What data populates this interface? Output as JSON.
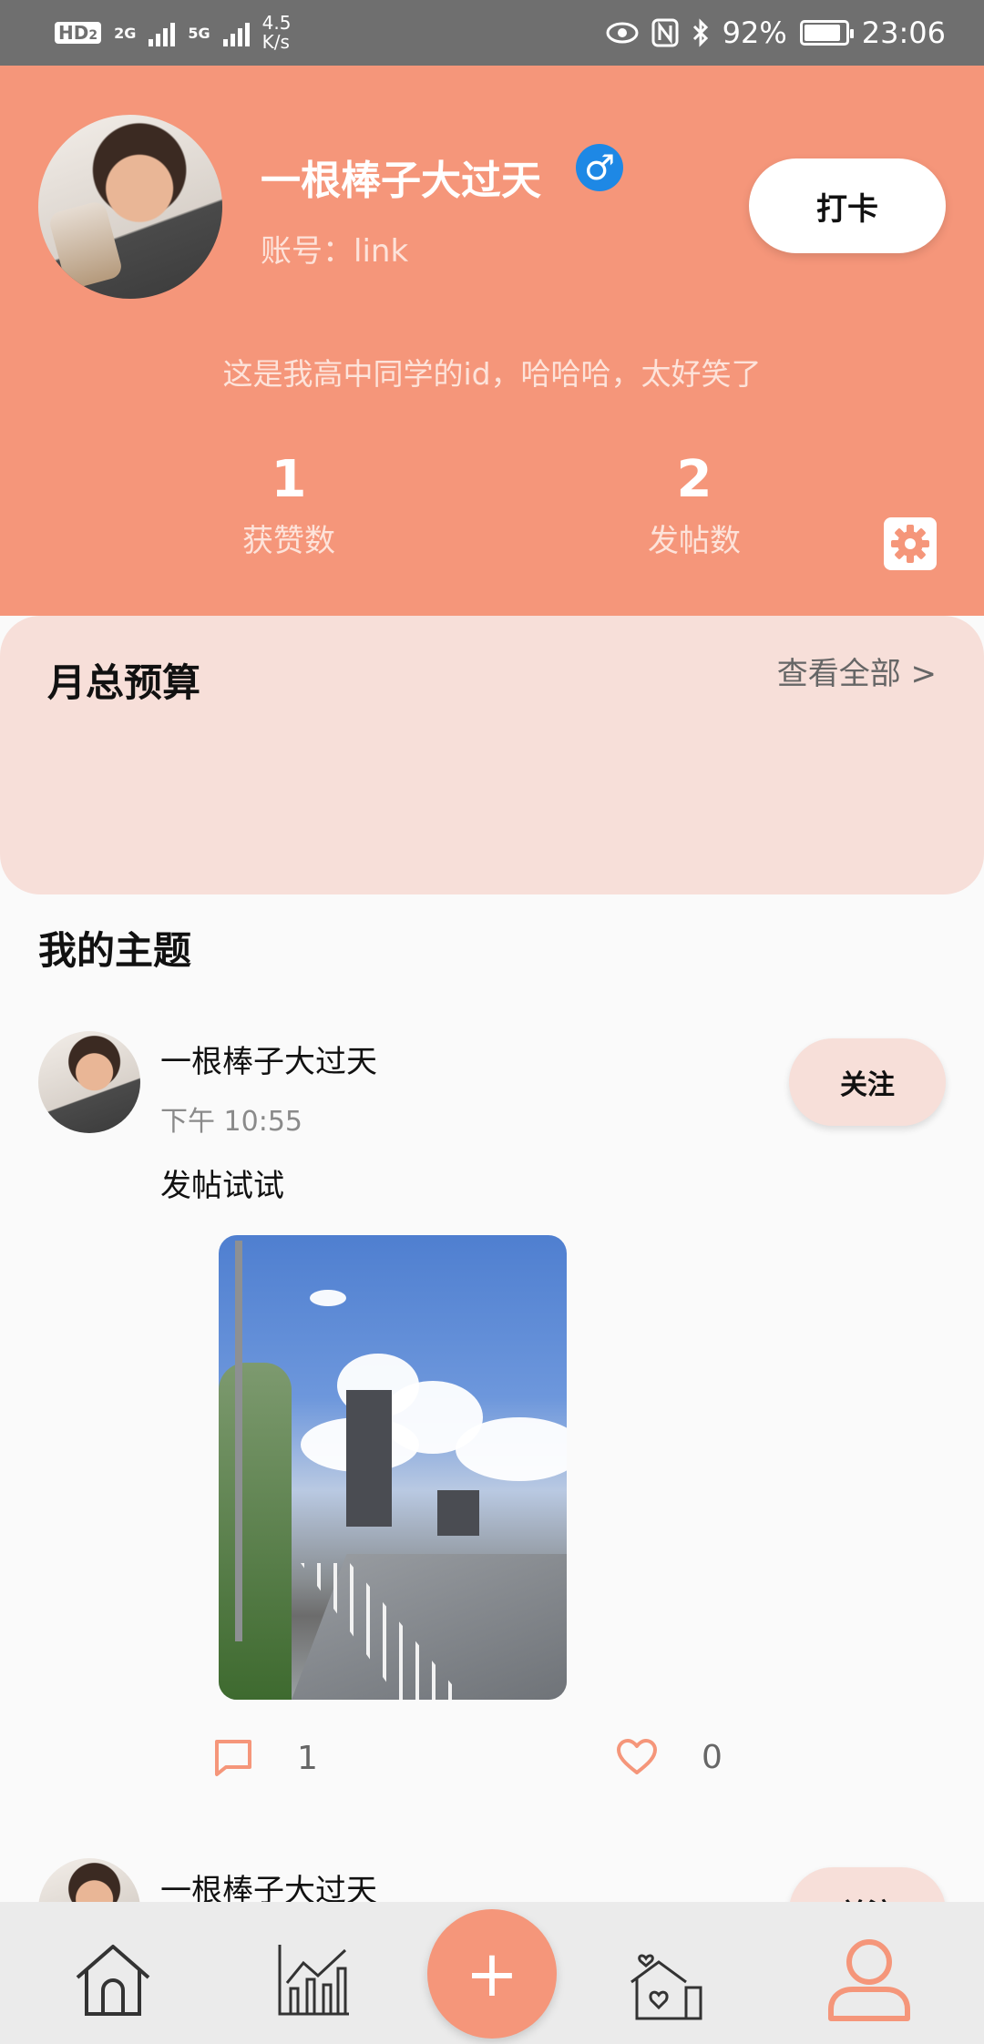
{
  "status_bar": {
    "hd_label": "HD",
    "hd_sub": "2",
    "net1": "2G",
    "net2": "5G",
    "speed_value": "4.5",
    "speed_unit": "K/s",
    "battery": "92%",
    "time": "23:06"
  },
  "profile": {
    "nickname": "一根棒子大过天",
    "gender_symbol": "♂",
    "account": "账号：link",
    "checkin_label": "打卡",
    "bio": "这是我高中同学的id，哈哈哈，太好笑了",
    "likes_count": "1",
    "likes_label": "获赞数",
    "posts_count": "2",
    "posts_label": "发帖数"
  },
  "budget": {
    "title": "月总预算",
    "more_label": "查看全部 >"
  },
  "topics": {
    "section_title": "我的主题",
    "posts": [
      {
        "author": "一根棒子大过天",
        "time": "下午 10:55",
        "text": "发帖试试",
        "follow_label": "关注",
        "comments": "1",
        "likes": "0"
      },
      {
        "author": "一根棒子大过天",
        "follow_label": "关注"
      }
    ]
  },
  "colors": {
    "accent": "#f5967a",
    "card": "#f7dfd9",
    "gender": "#1e88e5"
  },
  "nav": {
    "items": [
      "home-icon",
      "stats-icon",
      "add-icon",
      "community-icon",
      "profile-icon"
    ],
    "add_symbol": "+"
  }
}
